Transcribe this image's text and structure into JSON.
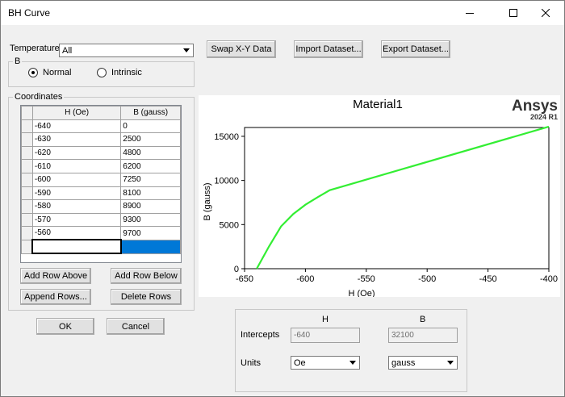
{
  "window": {
    "title": "BH Curve"
  },
  "temperature": {
    "label": "Temperature",
    "value": "All"
  },
  "b_group": {
    "label": "B",
    "normal": "Normal",
    "intrinsic": "Intrinsic",
    "selected": "Normal"
  },
  "toolbar": {
    "swap": "Swap X-Y Data",
    "import": "Import Dataset...",
    "export": "Export Dataset..."
  },
  "coordinates": {
    "label": "Coordinates",
    "headers": [
      "H (Oe)",
      "B (gauss)"
    ],
    "rows": [
      [
        "-640",
        "0"
      ],
      [
        "-630",
        "2500"
      ],
      [
        "-620",
        "4800"
      ],
      [
        "-610",
        "6200"
      ],
      [
        "-600",
        "7250"
      ],
      [
        "-590",
        "8100"
      ],
      [
        "-580",
        "8900"
      ],
      [
        "-570",
        "9300"
      ],
      [
        "-560",
        "9700"
      ],
      [
        "",
        ""
      ]
    ]
  },
  "row_buttons": {
    "add_above": "Add Row Above",
    "add_below": "Add Row Below",
    "append": "Append Rows...",
    "delete": "Delete Rows"
  },
  "dialog_buttons": {
    "ok": "OK",
    "cancel": "Cancel"
  },
  "intercepts": {
    "h_header": "H",
    "b_header": "B",
    "label": "Intercepts",
    "h_value": "-640",
    "b_value": "32100",
    "units_label": "Units",
    "h_unit": "Oe",
    "b_unit": "gauss"
  },
  "chart_data": {
    "type": "line",
    "title": "Material1",
    "brand": "Ansys",
    "version": "2024 R1",
    "xlabel": "H (Oe)",
    "ylabel": "B (gauss)",
    "xlim": [
      -650,
      -400
    ],
    "ylim": [
      0,
      16000
    ],
    "xticks": [
      -650,
      -600,
      -550,
      -500,
      -450,
      -400
    ],
    "yticks": [
      0,
      5000,
      10000,
      15000
    ],
    "color": "#33ee33",
    "x": [
      -640,
      -630,
      -620,
      -610,
      -600,
      -590,
      -580,
      -570,
      -560,
      -400
    ],
    "y": [
      0,
      2500,
      4800,
      6200,
      7250,
      8100,
      8900,
      9300,
      9700,
      16100
    ]
  }
}
